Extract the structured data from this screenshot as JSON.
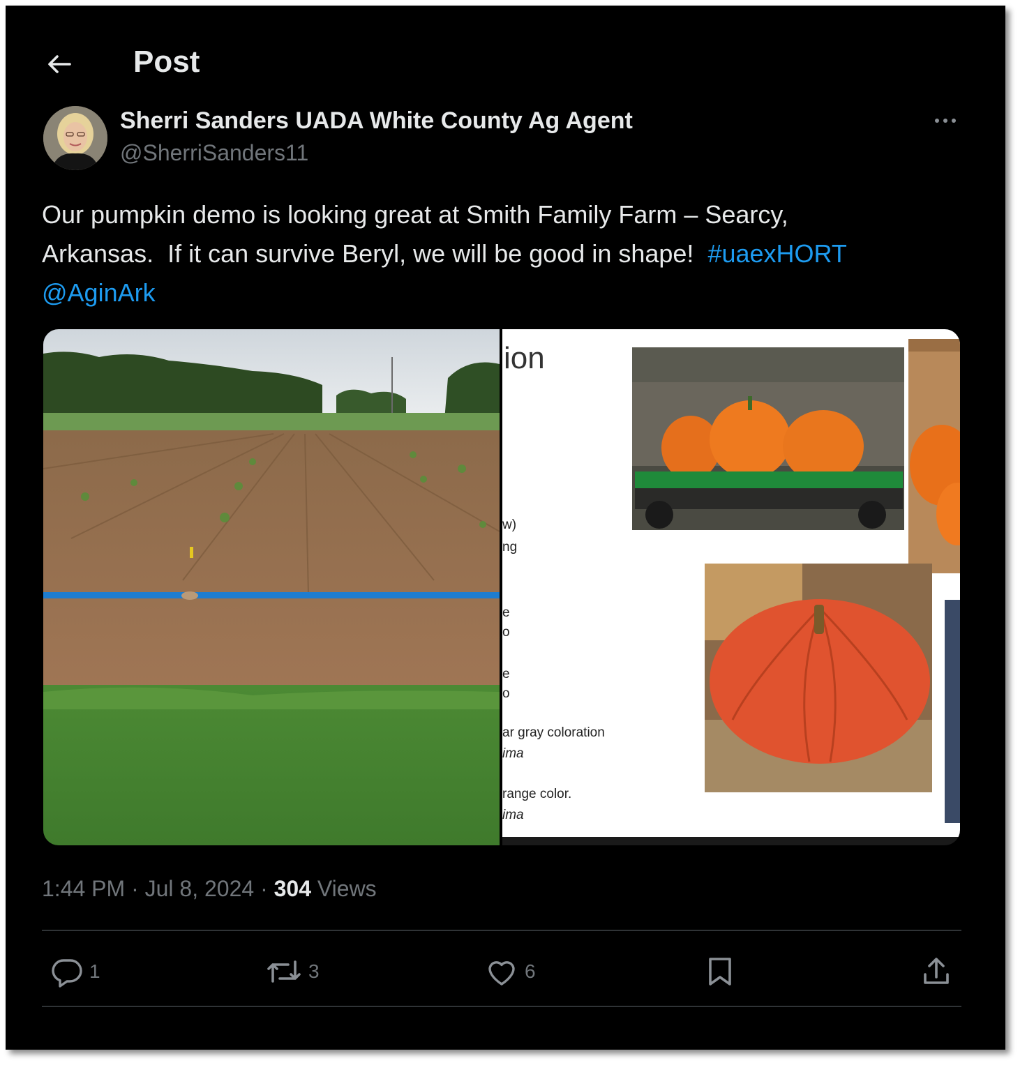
{
  "header": {
    "title": "Post"
  },
  "author": {
    "name": "Sherri Sanders UADA White County Ag Agent",
    "handle": "@SherriSanders11"
  },
  "post": {
    "line1": "Our pumpkin demo is looking great at Smith Family Farm – Searcy,",
    "line2_text": "Arkansas.  If it can survive Beryl, we will be good in shape!  ",
    "hashtag": "#uaexHORT",
    "mention": "@AginArk"
  },
  "media": {
    "slide_heading_fragment": "ion",
    "slide_fragments": [
      "w)",
      "ng",
      "e",
      "o",
      "e",
      "o",
      "ar gray coloration",
      "ima",
      "range color.",
      "ima"
    ]
  },
  "meta": {
    "time": "1:44 PM",
    "sep": " · ",
    "date": "Jul 8, 2024",
    "views_count": "304",
    "views_label": " Views"
  },
  "actions": {
    "replies": "1",
    "reposts": "3",
    "likes": "6"
  },
  "colors": {
    "background": "#000000",
    "text": "#e7e9ea",
    "muted": "#71767b",
    "link": "#1d9bf0",
    "divider": "#2f3336"
  },
  "icons": [
    "back-arrow-icon",
    "more-icon",
    "reply-icon",
    "repost-icon",
    "like-icon",
    "bookmark-icon",
    "share-icon"
  ]
}
